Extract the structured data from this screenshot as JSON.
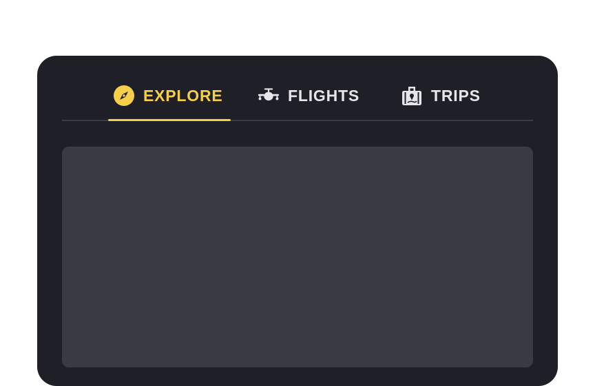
{
  "tabs": [
    {
      "label": "EXPLORE",
      "icon": "compass-icon",
      "active": true
    },
    {
      "label": "FLIGHTS",
      "icon": "airplane-icon",
      "active": false
    },
    {
      "label": "TRIPS",
      "icon": "luggage-icon",
      "active": false
    }
  ],
  "colors": {
    "accent": "#f5cf4a",
    "card_background": "#1f2027",
    "panel_background": "#3a3a44",
    "inactive_text": "#e6e6ea"
  }
}
